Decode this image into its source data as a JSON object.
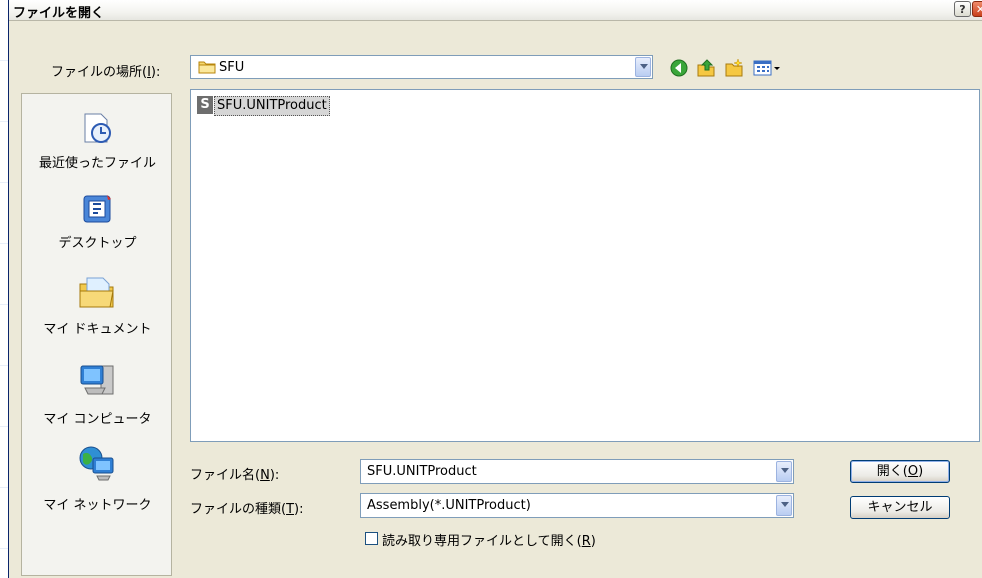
{
  "dialog": {
    "title": "ファイルを開く",
    "help": "?",
    "close": "✕"
  },
  "look_in": {
    "label_prefix": "ファイルの場所(",
    "label_key": "I",
    "label_suffix": "):",
    "value": "SFU"
  },
  "toolbar": {
    "icons": [
      "back-icon",
      "up-folder-icon",
      "new-folder-icon",
      "view-menu-icon"
    ]
  },
  "places": [
    {
      "label": "最近使ったファイル",
      "icon": "recent-files-icon"
    },
    {
      "label": "デスクトップ",
      "icon": "desktop-icon"
    },
    {
      "label": "マイ ドキュメント",
      "icon": "my-documents-icon"
    },
    {
      "label": "マイ コンピュータ",
      "icon": "my-computer-icon"
    },
    {
      "label": "マイ ネットワーク",
      "icon": "my-network-icon"
    }
  ],
  "files": [
    {
      "name": "SFU.UNITProduct",
      "icon_letter": "S"
    }
  ],
  "filename": {
    "label_prefix": "ファイル名(",
    "label_key": "N",
    "label_suffix": "):",
    "value": "SFU.UNITProduct"
  },
  "filetype": {
    "label_prefix": "ファイルの種類(",
    "label_key": "T",
    "label_suffix": "):",
    "value": "Assembly(*.UNITProduct)"
  },
  "readonly": {
    "label_prefix": "読み取り専用ファイルとして開く(",
    "label_key": "R",
    "label_suffix": ")",
    "checked": false
  },
  "buttons": {
    "open_prefix": "開く(",
    "open_key": "O",
    "open_suffix": ")",
    "cancel": "キャンセル"
  },
  "colors": {
    "dialog_bg": "#ece9d8",
    "accent": "#0a246a",
    "selection": "#d6d6d6"
  }
}
